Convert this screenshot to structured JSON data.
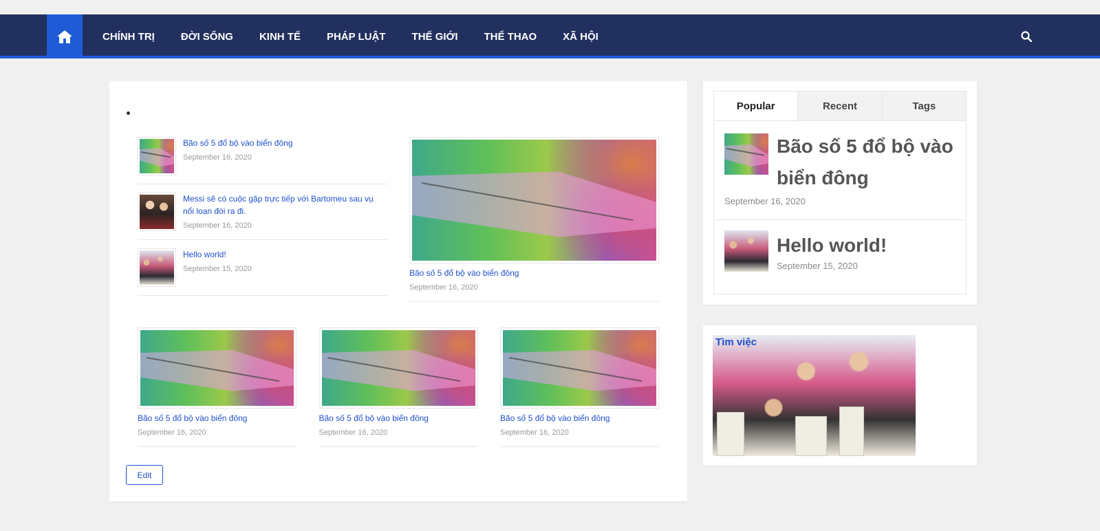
{
  "nav": {
    "items": [
      "CHÍNH TRỊ",
      "ĐỜI SỐNG",
      "KINH TẾ",
      "PHÁP LUẬT",
      "THẾ GIỚI",
      "THỂ THAO",
      "XÃ HỘI"
    ],
    "home_icon": "home-icon",
    "search_icon": "search-icon",
    "accent_color": "#1f5bd6",
    "bg_color": "#22305f"
  },
  "content": {
    "small_posts": [
      {
        "title": "Bão số 5 đổ bộ vào biển đông",
        "date": "September 16, 2020"
      },
      {
        "title": "Messi sẽ có cuộc gặp trực tiếp với Bartomeu sau vụ nổi loạn đòi ra đi.",
        "date": "September 16, 2020"
      },
      {
        "title": "Hello world!",
        "date": "September 15, 2020"
      }
    ],
    "featured": {
      "title": "Bão số 5 đổ bộ vào biển đông",
      "date": "September 16, 2020"
    },
    "grid_posts": [
      {
        "title": "Bão số 5 đổ bộ vào biển đông",
        "date": "September 16, 2020"
      },
      {
        "title": "Bão số 5 đổ bộ vào biển đông",
        "date": "September 16, 2020"
      },
      {
        "title": "Bão số 5 đổ bộ vào biển đông",
        "date": "September 16, 2020"
      }
    ],
    "edit_label": "Edit"
  },
  "sidebar": {
    "tabs": [
      "Popular",
      "Recent",
      "Tags"
    ],
    "active_tab": "Popular",
    "popular": [
      {
        "title": "Bão số 5 đổ bộ vào biển đông",
        "date": "September 16, 2020"
      },
      {
        "title": "Hello world!",
        "date": "September 15, 2020"
      }
    ],
    "ad_text": "Tìm việc"
  }
}
